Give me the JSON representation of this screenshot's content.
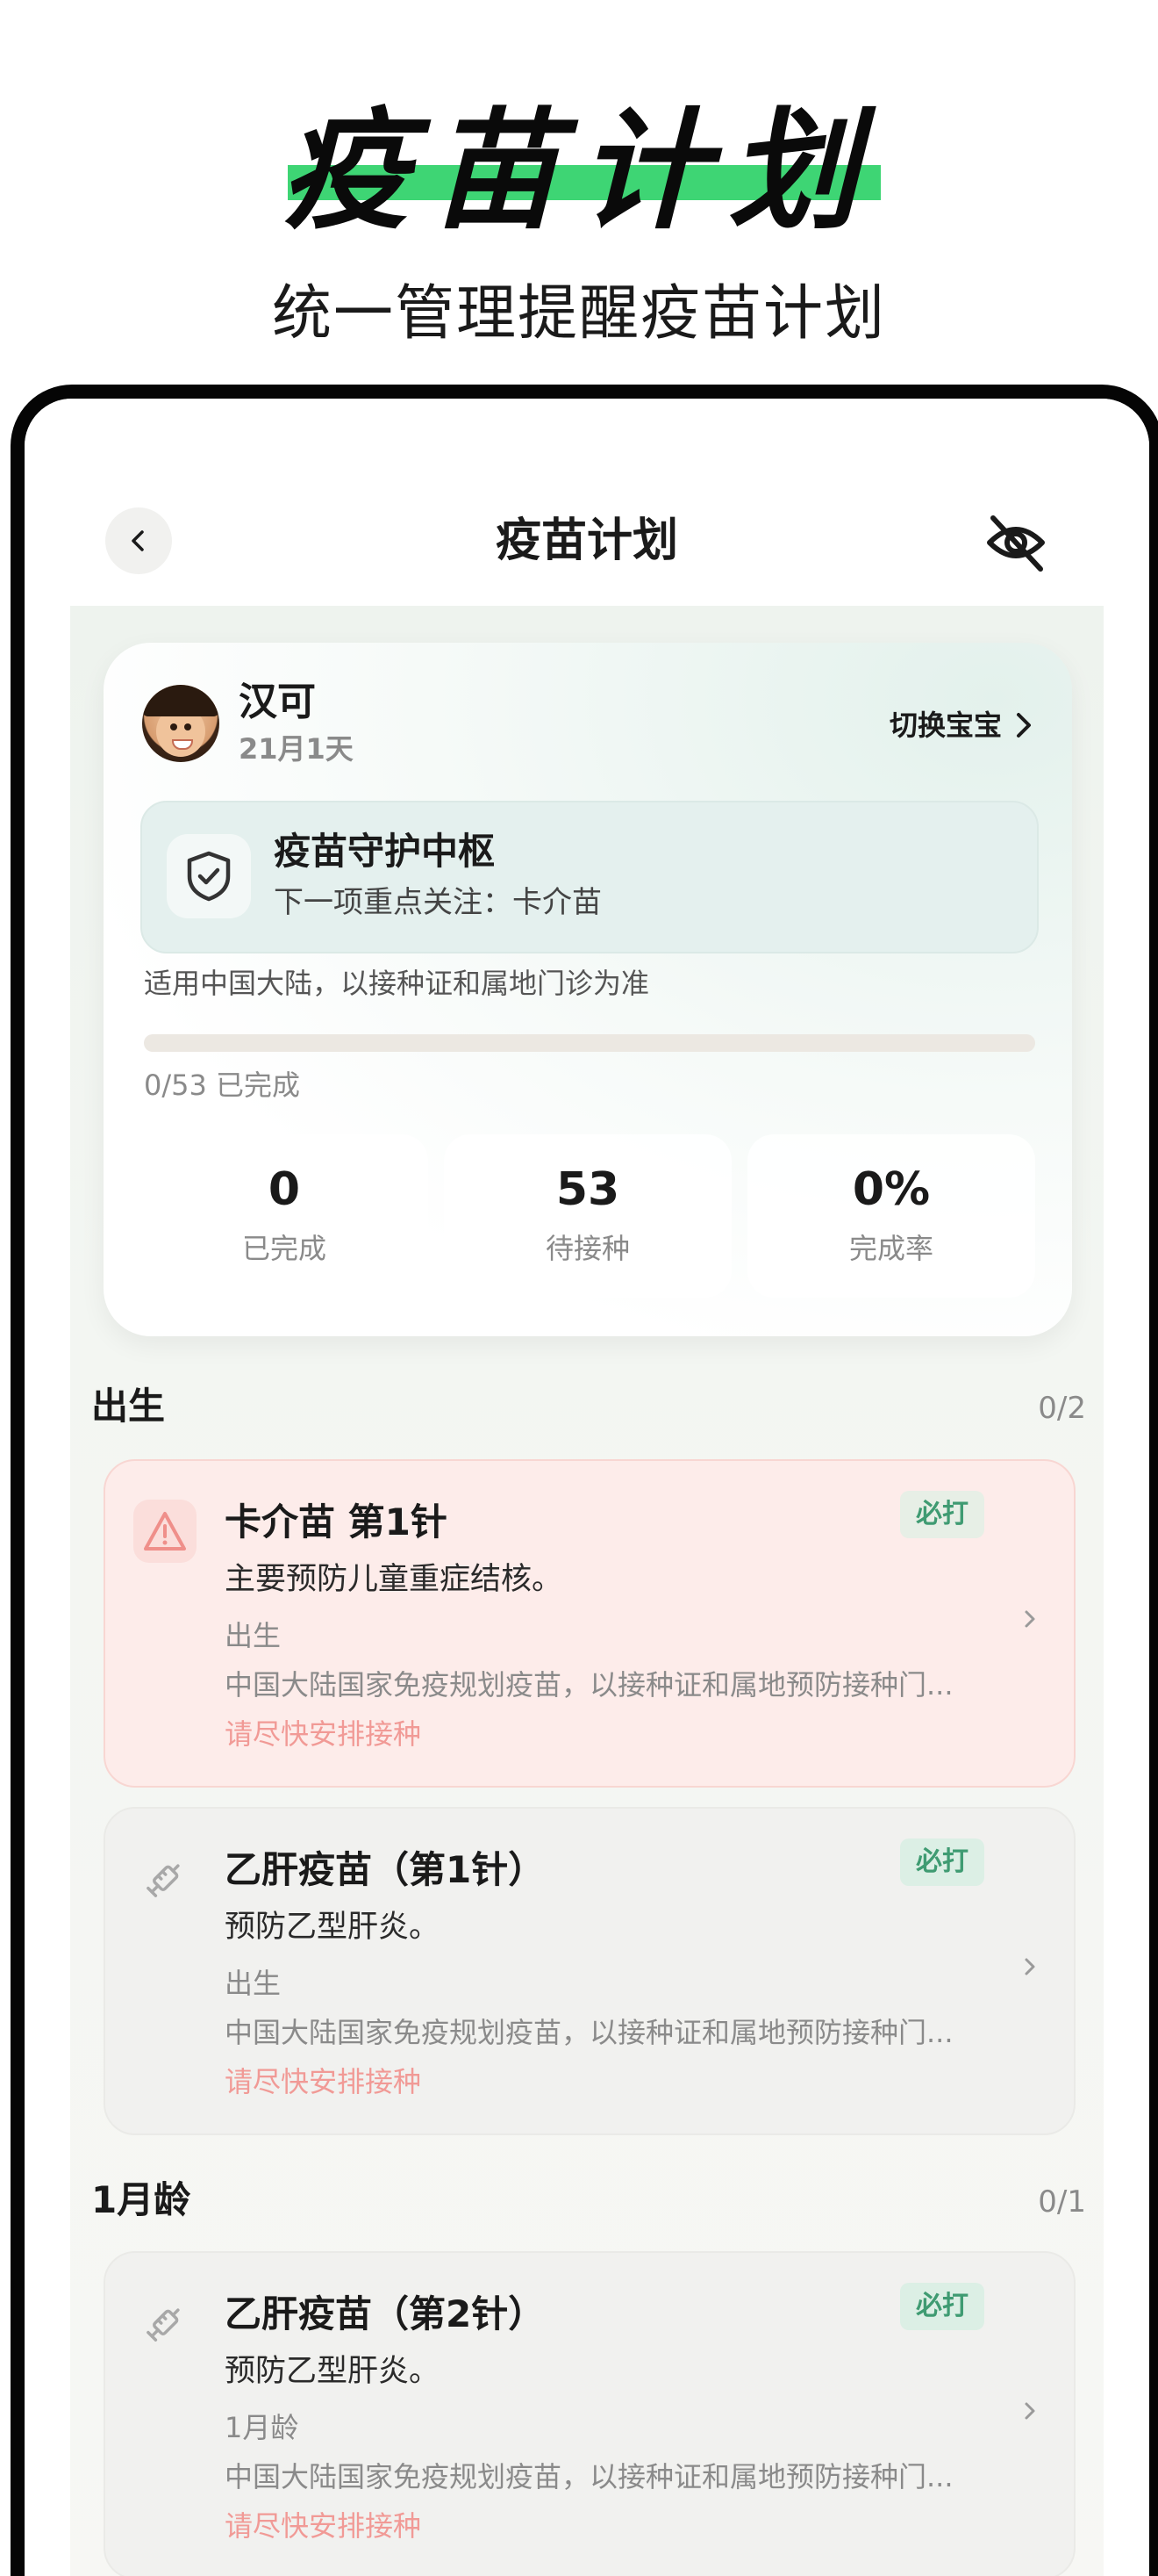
{
  "promo": {
    "title": "疫苗计划",
    "subtitle": "统一管理提醒疫苗计划"
  },
  "nav": {
    "title": "疫苗计划"
  },
  "baby": {
    "name": "汉可",
    "age": "21月1天",
    "switch_label": "切换宝宝"
  },
  "hub": {
    "title": "疫苗守护中枢",
    "subtitle": "下一项重点关注：卡介苗"
  },
  "region_note": "适用中国大陆，以接种证和属地门诊为准",
  "progress": {
    "label": "0/53 已完成",
    "fraction": 0
  },
  "stats": [
    {
      "value": "0",
      "label": "已完成"
    },
    {
      "value": "53",
      "label": "待接种"
    },
    {
      "value": "0%",
      "label": "完成率"
    }
  ],
  "sections": [
    {
      "title": "出生",
      "count": "0/2",
      "vaccines": [
        {
          "name": "卡介苗 第1针",
          "badge": "必打",
          "desc": "主要预防儿童重症结核。",
          "age": "出生",
          "note": "中国大陆国家免疫规划疫苗，以接种证和属地预防接种门...",
          "action": "请尽快安排接种",
          "icon": "warning-icon"
        },
        {
          "name": "乙肝疫苗（第1针）",
          "badge": "必打",
          "desc": "预防乙型肝炎。",
          "age": "出生",
          "note": "中国大陆国家免疫规划疫苗，以接种证和属地预防接种门...",
          "action": "请尽快安排接种",
          "icon": "syringe-icon"
        }
      ]
    },
    {
      "title": "1月龄",
      "count": "0/1",
      "vaccines": [
        {
          "name": "乙肝疫苗（第2针）",
          "badge": "必打",
          "desc": "预防乙型肝炎。",
          "age": "1月龄",
          "note": "中国大陆国家免疫规划疫苗，以接种证和属地预防接种门...",
          "action": "请尽快安排接种",
          "icon": "syringe-icon"
        }
      ]
    }
  ],
  "colors": {
    "accent": "#3ed574",
    "urgent_bg": "#fdecea",
    "badge_text": "#3f9b72",
    "action_text": "#f19a96"
  }
}
